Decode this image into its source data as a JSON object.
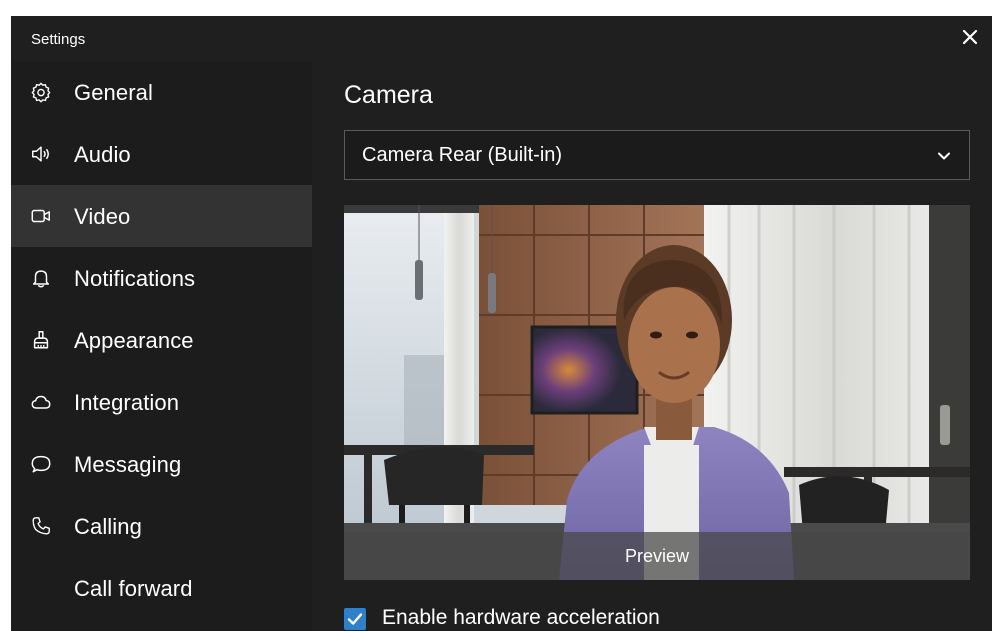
{
  "window": {
    "title": "Settings"
  },
  "sidebar": {
    "items": [
      {
        "label": "General",
        "icon": "gear-icon",
        "active": false
      },
      {
        "label": "Audio",
        "icon": "speaker-icon",
        "active": false
      },
      {
        "label": "Video",
        "icon": "video-camera-icon",
        "active": true
      },
      {
        "label": "Notifications",
        "icon": "bell-icon",
        "active": false
      },
      {
        "label": "Appearance",
        "icon": "brush-icon",
        "active": false
      },
      {
        "label": "Integration",
        "icon": "cloud-icon",
        "active": false
      },
      {
        "label": "Messaging",
        "icon": "chat-bubble-icon",
        "active": false
      },
      {
        "label": "Calling",
        "icon": "phone-icon",
        "active": false
      },
      {
        "label": "Call forward",
        "icon": "",
        "active": false
      }
    ]
  },
  "main": {
    "section_title": "Camera",
    "camera_select": {
      "value": "Camera Rear  (Built-in)"
    },
    "preview": {
      "label": "Preview"
    },
    "hardware_acceleration": {
      "label": "Enable hardware acceleration",
      "checked": true
    }
  },
  "colors": {
    "background": "#1f1f1f",
    "sidebar_active": "#333333",
    "accent": "#2f80c8",
    "text": "#ffffff"
  }
}
